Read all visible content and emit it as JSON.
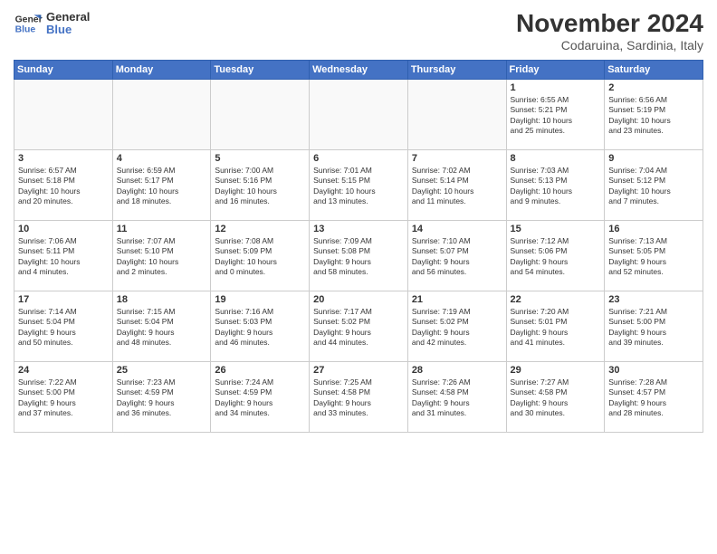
{
  "logo": {
    "line1": "General",
    "line2": "Blue"
  },
  "title": "November 2024",
  "subtitle": "Codaruina, Sardinia, Italy",
  "headers": [
    "Sunday",
    "Monday",
    "Tuesday",
    "Wednesday",
    "Thursday",
    "Friday",
    "Saturday"
  ],
  "weeks": [
    [
      {
        "day": "",
        "info": ""
      },
      {
        "day": "",
        "info": ""
      },
      {
        "day": "",
        "info": ""
      },
      {
        "day": "",
        "info": ""
      },
      {
        "day": "",
        "info": ""
      },
      {
        "day": "1",
        "info": "Sunrise: 6:55 AM\nSunset: 5:21 PM\nDaylight: 10 hours\nand 25 minutes."
      },
      {
        "day": "2",
        "info": "Sunrise: 6:56 AM\nSunset: 5:19 PM\nDaylight: 10 hours\nand 23 minutes."
      }
    ],
    [
      {
        "day": "3",
        "info": "Sunrise: 6:57 AM\nSunset: 5:18 PM\nDaylight: 10 hours\nand 20 minutes."
      },
      {
        "day": "4",
        "info": "Sunrise: 6:59 AM\nSunset: 5:17 PM\nDaylight: 10 hours\nand 18 minutes."
      },
      {
        "day": "5",
        "info": "Sunrise: 7:00 AM\nSunset: 5:16 PM\nDaylight: 10 hours\nand 16 minutes."
      },
      {
        "day": "6",
        "info": "Sunrise: 7:01 AM\nSunset: 5:15 PM\nDaylight: 10 hours\nand 13 minutes."
      },
      {
        "day": "7",
        "info": "Sunrise: 7:02 AM\nSunset: 5:14 PM\nDaylight: 10 hours\nand 11 minutes."
      },
      {
        "day": "8",
        "info": "Sunrise: 7:03 AM\nSunset: 5:13 PM\nDaylight: 10 hours\nand 9 minutes."
      },
      {
        "day": "9",
        "info": "Sunrise: 7:04 AM\nSunset: 5:12 PM\nDaylight: 10 hours\nand 7 minutes."
      }
    ],
    [
      {
        "day": "10",
        "info": "Sunrise: 7:06 AM\nSunset: 5:11 PM\nDaylight: 10 hours\nand 4 minutes."
      },
      {
        "day": "11",
        "info": "Sunrise: 7:07 AM\nSunset: 5:10 PM\nDaylight: 10 hours\nand 2 minutes."
      },
      {
        "day": "12",
        "info": "Sunrise: 7:08 AM\nSunset: 5:09 PM\nDaylight: 10 hours\nand 0 minutes."
      },
      {
        "day": "13",
        "info": "Sunrise: 7:09 AM\nSunset: 5:08 PM\nDaylight: 9 hours\nand 58 minutes."
      },
      {
        "day": "14",
        "info": "Sunrise: 7:10 AM\nSunset: 5:07 PM\nDaylight: 9 hours\nand 56 minutes."
      },
      {
        "day": "15",
        "info": "Sunrise: 7:12 AM\nSunset: 5:06 PM\nDaylight: 9 hours\nand 54 minutes."
      },
      {
        "day": "16",
        "info": "Sunrise: 7:13 AM\nSunset: 5:05 PM\nDaylight: 9 hours\nand 52 minutes."
      }
    ],
    [
      {
        "day": "17",
        "info": "Sunrise: 7:14 AM\nSunset: 5:04 PM\nDaylight: 9 hours\nand 50 minutes."
      },
      {
        "day": "18",
        "info": "Sunrise: 7:15 AM\nSunset: 5:04 PM\nDaylight: 9 hours\nand 48 minutes."
      },
      {
        "day": "19",
        "info": "Sunrise: 7:16 AM\nSunset: 5:03 PM\nDaylight: 9 hours\nand 46 minutes."
      },
      {
        "day": "20",
        "info": "Sunrise: 7:17 AM\nSunset: 5:02 PM\nDaylight: 9 hours\nand 44 minutes."
      },
      {
        "day": "21",
        "info": "Sunrise: 7:19 AM\nSunset: 5:02 PM\nDaylight: 9 hours\nand 42 minutes."
      },
      {
        "day": "22",
        "info": "Sunrise: 7:20 AM\nSunset: 5:01 PM\nDaylight: 9 hours\nand 41 minutes."
      },
      {
        "day": "23",
        "info": "Sunrise: 7:21 AM\nSunset: 5:00 PM\nDaylight: 9 hours\nand 39 minutes."
      }
    ],
    [
      {
        "day": "24",
        "info": "Sunrise: 7:22 AM\nSunset: 5:00 PM\nDaylight: 9 hours\nand 37 minutes."
      },
      {
        "day": "25",
        "info": "Sunrise: 7:23 AM\nSunset: 4:59 PM\nDaylight: 9 hours\nand 36 minutes."
      },
      {
        "day": "26",
        "info": "Sunrise: 7:24 AM\nSunset: 4:59 PM\nDaylight: 9 hours\nand 34 minutes."
      },
      {
        "day": "27",
        "info": "Sunrise: 7:25 AM\nSunset: 4:58 PM\nDaylight: 9 hours\nand 33 minutes."
      },
      {
        "day": "28",
        "info": "Sunrise: 7:26 AM\nSunset: 4:58 PM\nDaylight: 9 hours\nand 31 minutes."
      },
      {
        "day": "29",
        "info": "Sunrise: 7:27 AM\nSunset: 4:58 PM\nDaylight: 9 hours\nand 30 minutes."
      },
      {
        "day": "30",
        "info": "Sunrise: 7:28 AM\nSunset: 4:57 PM\nDaylight: 9 hours\nand 28 minutes."
      }
    ]
  ]
}
